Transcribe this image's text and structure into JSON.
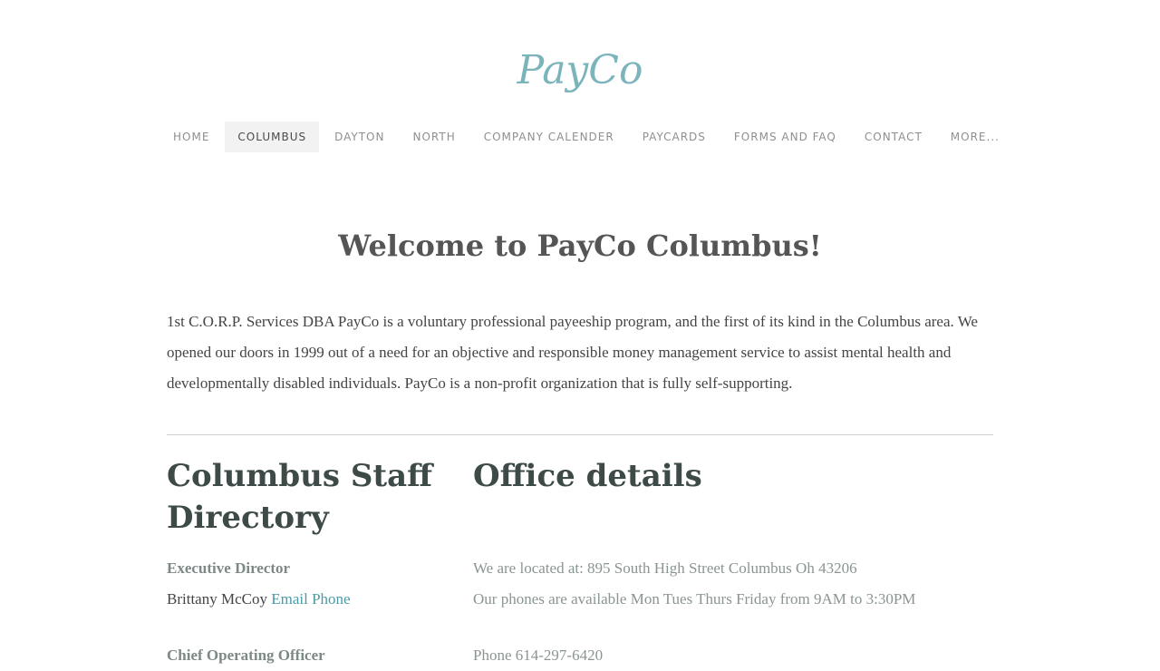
{
  "header": {
    "logo": "PayCo"
  },
  "nav": {
    "items": [
      {
        "label": "HOME"
      },
      {
        "label": "COLUMBUS"
      },
      {
        "label": "DAYTON"
      },
      {
        "label": "NORTH"
      },
      {
        "label": "COMPANY CALENDER"
      },
      {
        "label": "PAYCARDS"
      },
      {
        "label": "FORMS AND FAQ"
      },
      {
        "label": "CONTACT"
      },
      {
        "label": "MORE..."
      }
    ],
    "active": "COLUMBUS"
  },
  "main": {
    "title": "Welcome to PayCo Columbus!",
    "intro": "1st C.O.R.P. Services DBA PayCo is a voluntary professional payeeship program, and the first of its kind in the Columbus area. We opened our doors in 1999 out of a need for an objective and responsible money management service to assist mental health and developmentally disabled individuals. PayCo is a non-profit organization that is fully self-supporting."
  },
  "staff": {
    "title": "Columbus Staff Directory",
    "entries": [
      {
        "role": "Executive Director",
        "name": "Brittany McCoy",
        "email_label": "Email",
        "phone_label": "Phone"
      },
      {
        "role": "Chief Operating Officer"
      }
    ]
  },
  "office": {
    "title": "Office details",
    "location": "We are located at: 895 South High Street Columbus Oh 43206",
    "hours": "Our phones are available Mon Tues Thurs Friday from 9AM to 3:30PM",
    "phone": "Phone 614-297-6420"
  },
  "colors": {
    "logo": "#7bb5bb",
    "link": "#4c9aa6",
    "heading": "#3d4a48"
  }
}
